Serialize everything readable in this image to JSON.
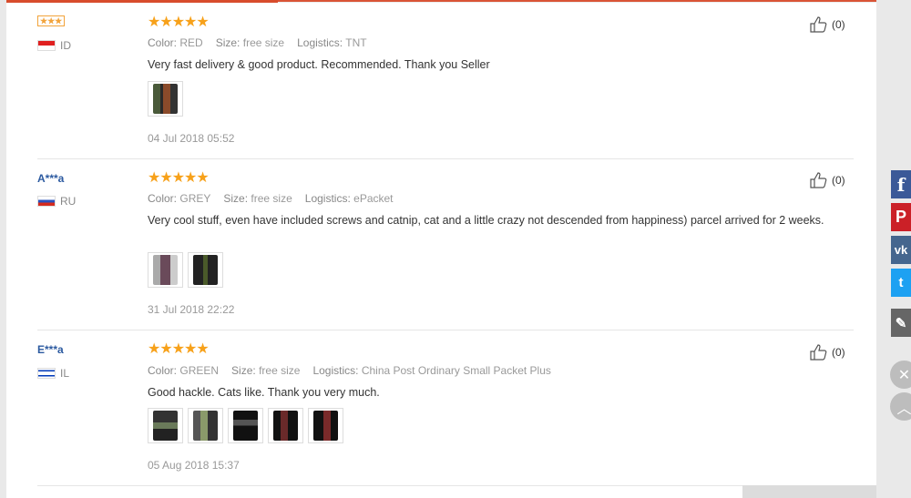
{
  "colors": {
    "accent": "#d84c2c",
    "star": "#f7a11a",
    "user": "#2c5aa0"
  },
  "labels": {
    "color": "Color:",
    "size": "Size:",
    "logistics": "Logistics:"
  },
  "reviews": [
    {
      "user": "I***",
      "country": "ID",
      "rating": "★★★★★",
      "color": "RED",
      "size": "free size",
      "logistics": "TNT",
      "text": "Very fast delivery & good product. Recommended. Thank you Seller",
      "date": "04 Jul 2018 05:52",
      "likes": "(0)"
    },
    {
      "user": "A***a",
      "country": "RU",
      "rating": "★★★★★",
      "color": "GREY",
      "size": "free size",
      "logistics": "ePacket",
      "text": "Very cool stuff, even have included screws and catnip, cat and a little crazy not descended from happiness) parcel arrived for 2 weeks.",
      "date": "31 Jul 2018 22:22",
      "likes": "(0)"
    },
    {
      "user": "E***a",
      "country": "IL",
      "rating": "★★★★★",
      "color": "GREEN",
      "size": "free size",
      "logistics": "China Post Ordinary Small Packet Plus",
      "text": "Good hackle. Cats like. Thank you very much.",
      "date": "05 Aug 2018 15:37",
      "likes": "(0)"
    }
  ],
  "share": {
    "facebook": "f",
    "pinterest": "P",
    "vk": "vk",
    "twitter": "t",
    "edit": "✎",
    "close": "✕",
    "up": "︿"
  }
}
